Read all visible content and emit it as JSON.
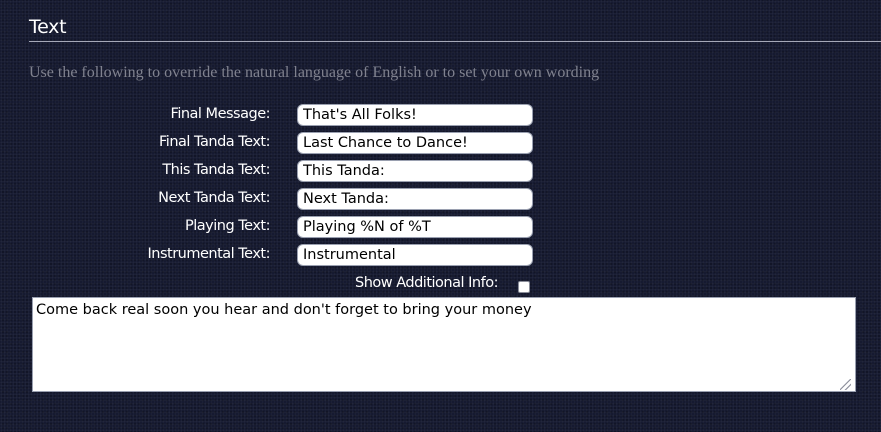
{
  "section": {
    "title": "Text",
    "description": "Use the following to override the natural language of English or to set your own wording"
  },
  "fields": [
    {
      "label": "Final Message:",
      "value": "That's All Folks!"
    },
    {
      "label": "Final Tanda Text:",
      "value": "Last Chance to Dance!"
    },
    {
      "label": "This Tanda Text:",
      "value": "This Tanda:"
    },
    {
      "label": "Next Tanda Text:",
      "value": "Next Tanda:"
    },
    {
      "label": "Playing Text:",
      "value": "Playing %N of %T"
    },
    {
      "label": "Instrumental Text:",
      "value": "Instrumental"
    }
  ],
  "additional_info": {
    "label": "Show Additional Info:",
    "checked": false
  },
  "message": {
    "value": "Come back real soon you hear and don't forget to bring your money"
  }
}
